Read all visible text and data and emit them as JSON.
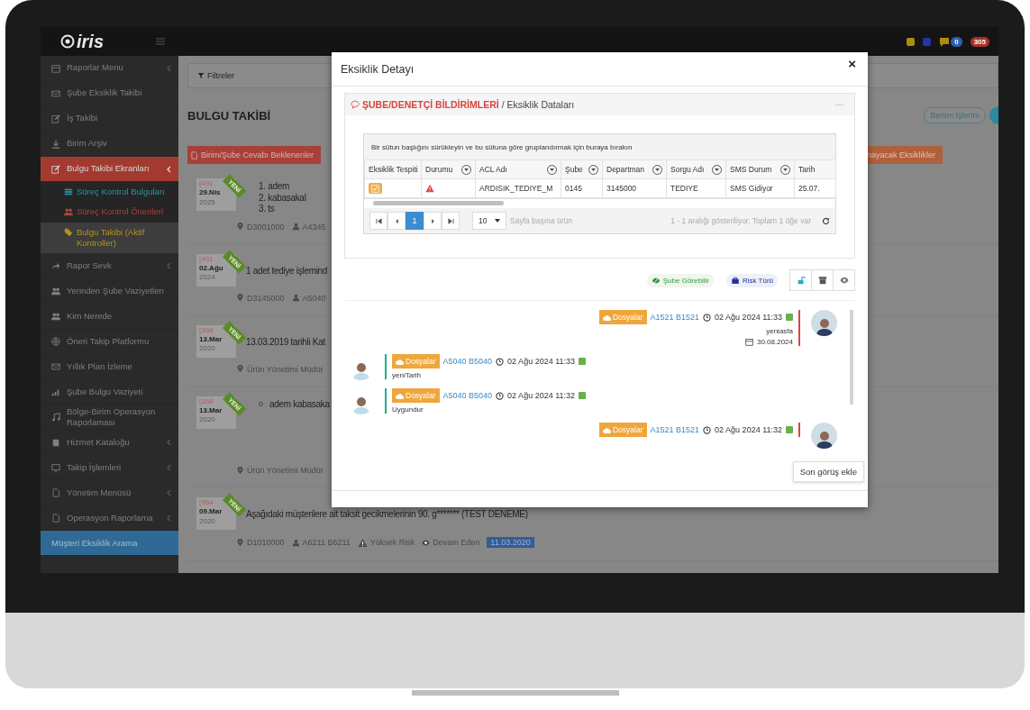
{
  "topbar": {
    "logo": "iris",
    "badges": [
      {
        "text": "0",
        "color": "#2f5fb0"
      },
      {
        "text": "305",
        "color": "#a8302a"
      }
    ]
  },
  "sidebar": {
    "items": [
      {
        "label": "Raporlar Menu",
        "submenu": true,
        "expanded": false,
        "selected": false
      },
      {
        "label": "Şube Eksiklik Takibi",
        "submenu": false,
        "expanded": false,
        "selected": false
      },
      {
        "label": "İş Takibi",
        "submenu": false,
        "expanded": false,
        "selected": false
      },
      {
        "label": "Birim Arşiv",
        "submenu": false,
        "expanded": false,
        "selected": false
      },
      {
        "label": "Bulgu Takibi Ekranları",
        "submenu": true,
        "expanded": true,
        "selected": false,
        "children": [
          {
            "label": "Süreç Kontrol Bulguları",
            "color": "#2b93a6",
            "selected": false
          },
          {
            "label": "Süreç Kontrol Önerileri",
            "color": "#a8443a",
            "selected": false
          },
          {
            "label": "Bulgu Takibi (Aktif Kontroller)",
            "color": "#b39320",
            "selected": true
          }
        ]
      },
      {
        "label": "Rapor Sevk",
        "submenu": true,
        "expanded": false,
        "selected": false
      },
      {
        "label": "Yerinden Şube Vaziyetleri",
        "submenu": false,
        "expanded": false,
        "selected": false
      },
      {
        "label": "Kim Nerede",
        "submenu": false,
        "expanded": false,
        "selected": false
      },
      {
        "label": "Öneri Takip Platformu",
        "submenu": false,
        "expanded": false,
        "selected": false
      },
      {
        "label": "Yıllık Plan İzleme",
        "submenu": false,
        "expanded": false,
        "selected": false
      },
      {
        "label": "Şube Bulgu Vaziyeti",
        "submenu": false,
        "expanded": false,
        "selected": false
      },
      {
        "label": "Bölge-Birim Operasyon Raporlaması",
        "submenu": false,
        "expanded": false,
        "selected": false
      },
      {
        "label": "Hizmet Kataloğu",
        "submenu": true,
        "expanded": false,
        "selected": false
      },
      {
        "label": "Takip İşlemleri",
        "submenu": true,
        "expanded": false,
        "selected": false
      },
      {
        "label": "Yönetim Menüsü",
        "submenu": true,
        "expanded": false,
        "selected": false
      },
      {
        "label": "Operasyon Raporlama",
        "submenu": true,
        "expanded": false,
        "selected": false
      },
      {
        "label": "Müşteri Eksiklik Arama",
        "submenu": false,
        "expanded": false,
        "selected": true
      }
    ]
  },
  "page": {
    "filter_label": "Filtreler",
    "title": "BULGU TAKİBİ",
    "my_tasks_button": "Benim İşlerim",
    "tabs": [
      {
        "label": "Birim/Şube Cevabı Beklenenler",
        "color": "#a8403a"
      },
      {
        "label": "nayacak Eksiklikler",
        "color": "#b0603c"
      }
    ],
    "items": [
      {
        "id": "[491",
        "day": "29.Nis",
        "year": "2025",
        "ribbon": "YENİ",
        "kind": "list",
        "lines": [
          "1. adem",
          "2. kabasakal",
          "3. ts"
        ],
        "meta": [
          {
            "kind": "location",
            "text": "D3001000"
          },
          {
            "kind": "user",
            "text": "A4345"
          }
        ]
      },
      {
        "id": "[491",
        "day": "02.Ağu",
        "year": "2024",
        "ribbon": "YENİ",
        "kind": "text",
        "lines": [
          "1 adet tediye işlemind"
        ],
        "meta": [
          {
            "kind": "location",
            "text": "D3145000"
          },
          {
            "kind": "user",
            "text": "A5040"
          }
        ]
      },
      {
        "id": "[368",
        "day": "13.Mar",
        "year": "2020",
        "ribbon": "YENİ",
        "kind": "text",
        "lines": [
          "13.03.2019 tarihli Kat"
        ],
        "meta": [
          {
            "kind": "location",
            "text": "Ürün Yönetimi Müdür"
          }
        ]
      },
      {
        "id": "[368",
        "day": "13.Mar",
        "year": "2020",
        "ribbon": "YENİ",
        "kind": "bullet",
        "lines": [
          "adem kabasaka"
        ],
        "meta": [
          {
            "kind": "location",
            "text": "Ürün Yönetimi Müdür"
          }
        ]
      },
      {
        "id": "[364",
        "day": "09.Mar",
        "year": "2020",
        "ribbon": "YENİ",
        "kind": "text",
        "lines": [
          "Aşağıdaki müşterilere ait taksit gecikmelerinin 90. g******* (TEST DENEME)"
        ],
        "meta": [
          {
            "kind": "location",
            "text": "D1010000"
          },
          {
            "kind": "user",
            "text": "A6211 B6211"
          },
          {
            "kind": "risk",
            "text": "Yüksek Risk"
          },
          {
            "kind": "status",
            "text": "Devam Eden"
          },
          {
            "kind": "date",
            "text": "11.03.2020"
          }
        ]
      }
    ]
  },
  "modal": {
    "title": "Eksiklik Detayı",
    "close": "×",
    "panel": {
      "title": "ŞUBE/DENETÇİ BİLDİRİMLERİ",
      "subtitle": "/ Eksiklik Dataları",
      "grid": {
        "group_hint": "Bir sütun başlığını sürükleyin ve bu sütuna göre gruplandırmak için buraya bırakın",
        "columns": [
          {
            "label": "Eksiklik Tespiti",
            "filter": false
          },
          {
            "label": "Durumu",
            "filter": true
          },
          {
            "label": "ACL Adı",
            "filter": true
          },
          {
            "label": "Şube",
            "filter": true
          },
          {
            "label": "Departman",
            "filter": true
          },
          {
            "label": "Sorgu Adı",
            "filter": true
          },
          {
            "label": "SMS Durum",
            "filter": true
          },
          {
            "label": "Tarih",
            "filter": false
          }
        ],
        "rows": [
          {
            "cells": [
              {
                "kind": "action"
              },
              {
                "kind": "alert"
              },
              {
                "kind": "text",
                "text": "ARDISIK_TEDIYE_M"
              },
              {
                "kind": "text",
                "text": "0145"
              },
              {
                "kind": "text",
                "text": "3145000"
              },
              {
                "kind": "text",
                "text": "TEDIYE"
              },
              {
                "kind": "text",
                "text": "SMS Gidiyor"
              },
              {
                "kind": "text",
                "text": "25.07."
              }
            ]
          }
        ],
        "pager": {
          "pages": [
            {
              "label": "1",
              "selected": true
            }
          ],
          "page_size": "10",
          "page_size_label": "Sayfa başına ürün",
          "summary": "1 - 1 aralığı gösteriliyor. Toplam 1 öğe var"
        }
      }
    },
    "actions": [
      {
        "kind": "visibility",
        "label": "Şube Görebilir"
      },
      {
        "kind": "risk",
        "label": "Risk Türü"
      }
    ],
    "comments": [
      {
        "kind": "right",
        "files_label": "Dosyalar",
        "user": "A1521 B1521",
        "time": "02 Ağu 2024 11:33",
        "text": "yeniasfa",
        "due_date": "30.08.2024"
      },
      {
        "kind": "left",
        "files_label": "Dosyalar",
        "user": "A5040 B5040",
        "time": "02 Ağu 2024 11:33",
        "text": "yeniTarih"
      },
      {
        "kind": "left",
        "files_label": "Dosyalar",
        "user": "A5040 B5040",
        "time": "02 Ağu 2024 11:32",
        "text": "Uygundur"
      },
      {
        "kind": "right",
        "files_label": "Dosyalar",
        "user": "A1521 B1521",
        "time": "02 Ağu 2024 11:32"
      }
    ],
    "add_comment_button": "Son görüş ekle"
  }
}
